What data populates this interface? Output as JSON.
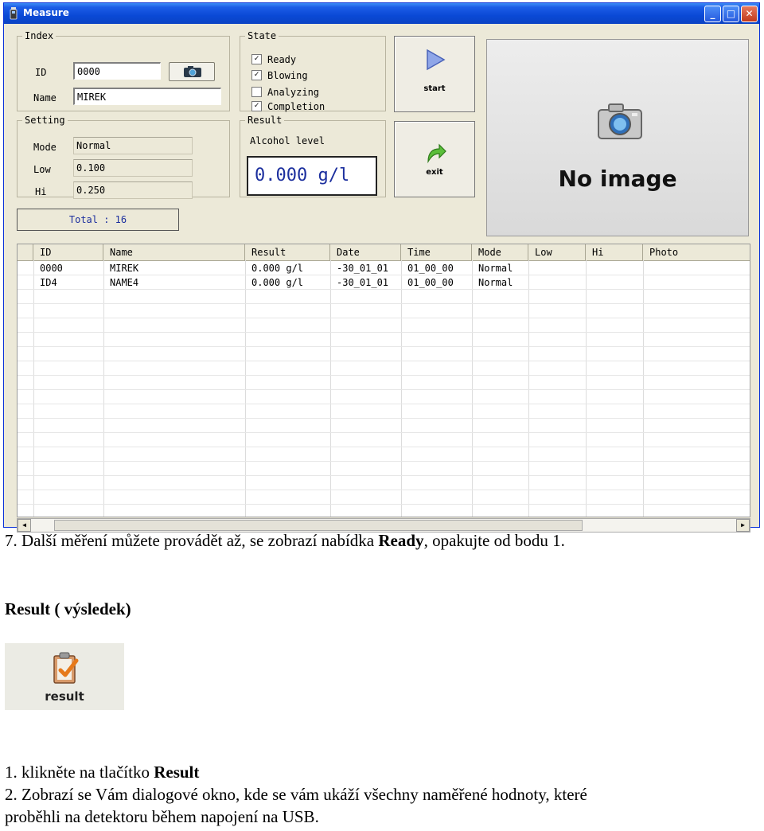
{
  "window": {
    "title": "Measure",
    "controls": [
      "_",
      "□",
      "✕"
    ]
  },
  "index": {
    "legend": "Index",
    "id_label": "ID",
    "id_value": "0000",
    "name_label": "Name",
    "name_value": "MIREK",
    "camera_icon": "camera-icon"
  },
  "state": {
    "legend": "State",
    "items": [
      {
        "label": "Ready",
        "checked": true
      },
      {
        "label": "Blowing",
        "checked": true
      },
      {
        "label": "Analyzing",
        "checked": false
      },
      {
        "label": "Completion",
        "checked": true
      }
    ]
  },
  "setting": {
    "legend": "Setting",
    "mode_label": "Mode",
    "mode_value": "Normal",
    "low_label": "Low",
    "low_value": "0.100",
    "hi_label": "Hi",
    "hi_value": "0.250"
  },
  "result": {
    "legend": "Result",
    "alcohol_label": "Alcohol level",
    "value": "0.000 g/l"
  },
  "buttons": {
    "start": "start",
    "exit": "exit"
  },
  "preview": {
    "text": "No image"
  },
  "total": "Total : 16",
  "table": {
    "columns": [
      "ID",
      "Name",
      "Result",
      "Date",
      "Time",
      "Mode",
      "Low",
      "Hi",
      "Photo"
    ],
    "rows": [
      [
        "0000",
        "MIREK",
        "0.000 g/l",
        "-30_01_01",
        "01_00_00",
        "Normal",
        "",
        "",
        ""
      ],
      [
        "ID4",
        "NAME4",
        "0.000 g/l",
        "-30_01_01",
        "01_00_00",
        "Normal",
        "",
        "",
        ""
      ]
    ]
  },
  "colors": {
    "titlebar": "#0a49d6",
    "window_bg": "#ece9d8",
    "accent_text": "#1c2f9e"
  },
  "doc": {
    "line7_a": "7. Další měření můžete provádět až, se zobrazí nabídka ",
    "line7_b": "Ready",
    "line7_c": ", opakujte od bodu 1.",
    "heading": "Result ( výsledek)",
    "result_button_label": "result",
    "step1_a": "1. klikněte na tlačítko ",
    "step1_b": "Result",
    "step2_line1": "2. Zobrazí se Vám dialogové okno, kde se vám ukáží všechny naměřené hodnoty, které",
    "step2_line2": "proběhli na detektoru během napojení na USB."
  }
}
